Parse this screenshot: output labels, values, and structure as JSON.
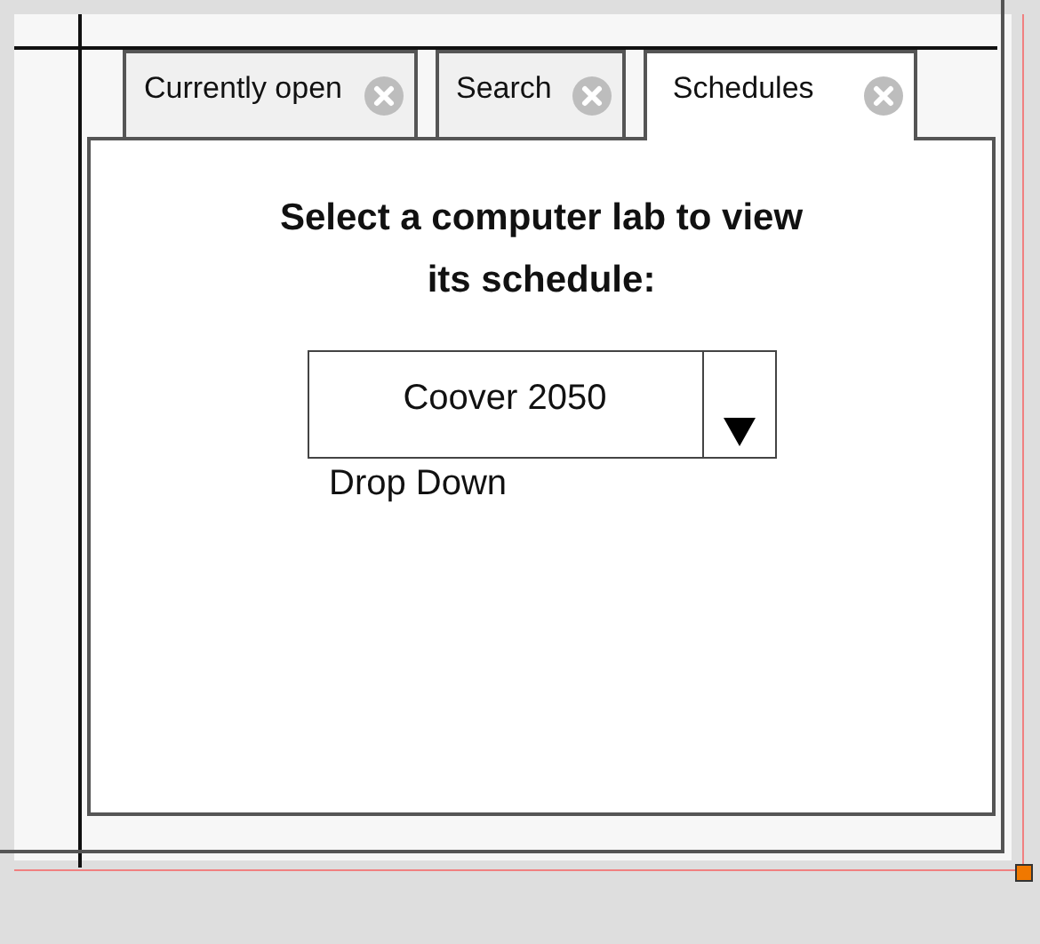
{
  "tabs": [
    {
      "label": "Currently open",
      "selected": false
    },
    {
      "label": "Search",
      "selected": false
    },
    {
      "label": "Schedules",
      "selected": true
    }
  ],
  "heading": "Select a computer lab to view its schedule:",
  "dropdown": {
    "value": "Coover 2050",
    "caption": "Drop Down"
  }
}
